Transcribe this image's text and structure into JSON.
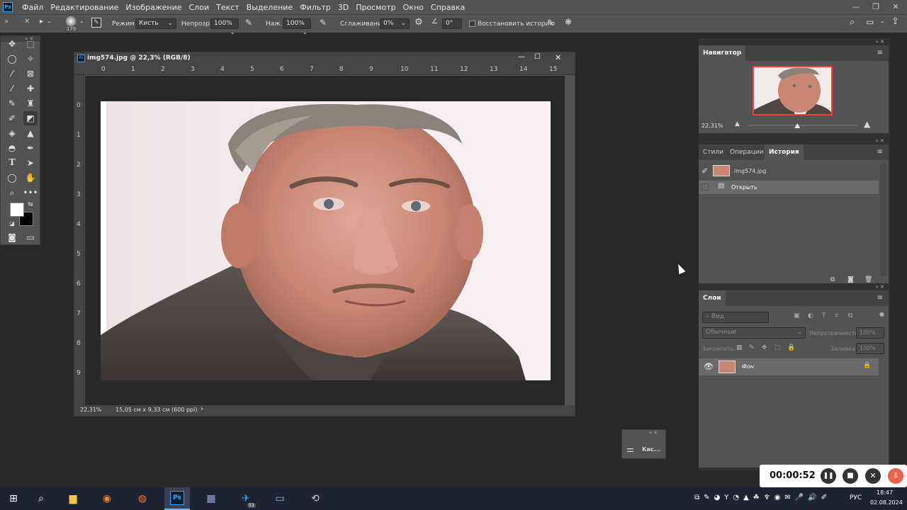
{
  "app": {
    "logo": "Ps"
  },
  "menu": [
    "Файл",
    "Редактирование",
    "Изображение",
    "Слои",
    "Текст",
    "Выделение",
    "Фильтр",
    "3D",
    "Просмотр",
    "Окно",
    "Справка"
  ],
  "options_bar": {
    "brush_size": "175",
    "mode_label": "Режим:",
    "mode_value": "Кисть",
    "opacity_label": "Непрозр.:",
    "opacity_value": "100%",
    "pressure_label": "Наж.:",
    "pressure_value": "100%",
    "smoothing_label": "Сглаживание:",
    "smoothing_value": "0%",
    "angle_value": "0°",
    "restore_history_label": "Восстановить историю"
  },
  "document": {
    "title": "img574.jpg @ 22,3% (RGB/8)",
    "ruler_top": [
      "0",
      "1",
      "2",
      "3",
      "4",
      "5",
      "6",
      "7",
      "8",
      "9",
      "10",
      "11",
      "12",
      "13",
      "14",
      "15"
    ],
    "ruler_left": [
      "0",
      "1",
      "2",
      "3",
      "4",
      "5",
      "6",
      "7",
      "8",
      "9"
    ],
    "zoom": "22,31%",
    "doc_info": "15,05 см x 9,33 см (600 ppi)"
  },
  "navigator": {
    "title": "Навигатор",
    "zoom": "22,31%",
    "zoom_slider_fraction": 0.45
  },
  "history": {
    "tabs": [
      "Стили",
      "Операции",
      "История"
    ],
    "snapshot_label": "img574.jpg",
    "items": [
      "Открыть"
    ]
  },
  "layers": {
    "title": "Слои",
    "search_placeholder": "Вид",
    "blend_mode": "Обычные",
    "opacity_label": "Непрозрачность:",
    "opacity_value": "100%",
    "lock_label": "Закрепить:",
    "fill_label": "Заливка:",
    "fill_value": "100%",
    "items": [
      {
        "name": "Фон"
      }
    ]
  },
  "float_panel": {
    "label": "Кис..."
  },
  "recorder": {
    "time": "00:00:52"
  },
  "taskbar": {
    "language": "РУС",
    "time": "18:47",
    "date": "02.08.2024",
    "telegram_badge": "53"
  },
  "colors": {
    "accent_recorder_red": "#e8634a",
    "panel_bg": "#535353",
    "workspace_bg": "#282828",
    "nav_viewbox": "#ff3b3b"
  }
}
